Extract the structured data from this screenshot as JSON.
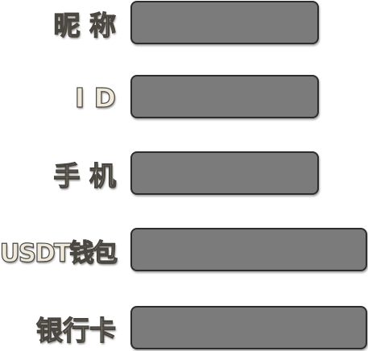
{
  "form": {
    "fields": [
      {
        "label": "昵 称",
        "value": ""
      },
      {
        "label": "I D",
        "value": ""
      },
      {
        "label": "手 机",
        "value": ""
      },
      {
        "label": "USDT钱包",
        "value": ""
      },
      {
        "label": "银行卡",
        "value": ""
      }
    ]
  },
  "colors": {
    "field_background": "#7b7b7b",
    "field_border": "#2d2d2d",
    "label_fill": "#efe9dc",
    "label_outline": "#4a4640",
    "page_background": "#ffffff"
  }
}
